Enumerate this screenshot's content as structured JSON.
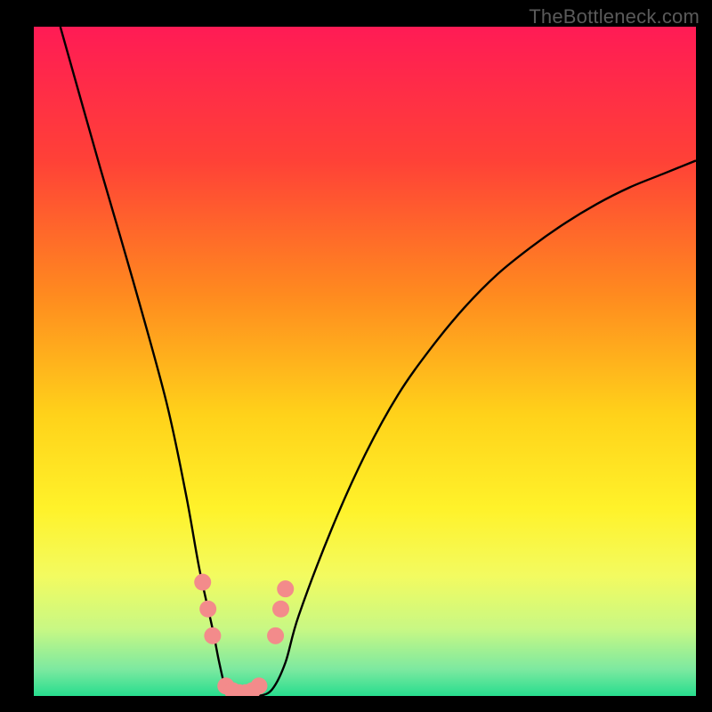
{
  "watermark": "TheBottleneck.com",
  "chart_data": {
    "type": "line",
    "title": "",
    "xlabel": "",
    "ylabel": "",
    "xlim": [
      0,
      100
    ],
    "ylim": [
      0,
      100
    ],
    "series": [
      {
        "name": "bottleneck-curve",
        "x": [
          4,
          10,
          15,
          20,
          23,
          25,
          27,
          28,
          29,
          30,
          32,
          34,
          36,
          38,
          40,
          45,
          50,
          55,
          60,
          65,
          70,
          75,
          80,
          85,
          90,
          95,
          100
        ],
        "values": [
          100,
          79,
          62,
          44,
          30,
          19,
          10,
          5,
          1,
          0,
          0,
          0,
          1,
          5,
          12,
          25,
          36,
          45,
          52,
          58,
          63,
          67,
          70.5,
          73.5,
          76,
          78,
          80
        ]
      }
    ],
    "markers": {
      "name": "highlighted-points",
      "color": "#f38b8b",
      "points": [
        {
          "x": 25.5,
          "y": 17
        },
        {
          "x": 26.3,
          "y": 13
        },
        {
          "x": 27.0,
          "y": 9
        },
        {
          "x": 29.0,
          "y": 1.5
        },
        {
          "x": 30.0,
          "y": 0.8
        },
        {
          "x": 31.0,
          "y": 0.5
        },
        {
          "x": 32.0,
          "y": 0.5
        },
        {
          "x": 33.0,
          "y": 0.8
        },
        {
          "x": 34.0,
          "y": 1.5
        },
        {
          "x": 36.5,
          "y": 9
        },
        {
          "x": 37.3,
          "y": 13
        },
        {
          "x": 38.0,
          "y": 16
        }
      ]
    },
    "background_gradient": {
      "stops": [
        {
          "offset": 0.0,
          "color": "#ff1b55"
        },
        {
          "offset": 0.2,
          "color": "#ff4137"
        },
        {
          "offset": 0.4,
          "color": "#ff8a1f"
        },
        {
          "offset": 0.58,
          "color": "#ffd21a"
        },
        {
          "offset": 0.72,
          "color": "#fff22a"
        },
        {
          "offset": 0.82,
          "color": "#f3fb60"
        },
        {
          "offset": 0.9,
          "color": "#c8f884"
        },
        {
          "offset": 0.96,
          "color": "#7de9a0"
        },
        {
          "offset": 1.0,
          "color": "#27dd8e"
        }
      ]
    }
  }
}
